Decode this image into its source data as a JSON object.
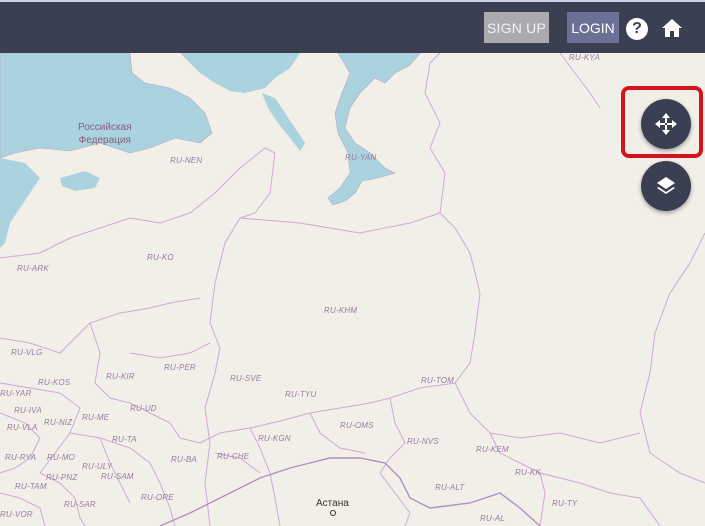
{
  "header": {
    "signup_label": "SIGN UP",
    "login_label": "LOGIN",
    "help_glyph": "?",
    "icons": [
      "help-icon",
      "home-icon"
    ]
  },
  "controls": {
    "pan_button_icon": "move-arrows-icon",
    "layers_button_icon": "layers-icon",
    "accent": "#3a3f51",
    "highlight_color": "#d4141c"
  },
  "map": {
    "place_labels": {
      "russia_line1": "Российская",
      "russia_line2": "Федерация"
    },
    "city_labels": {
      "astana": "Астана"
    },
    "region_labels": [
      "RU-KYA",
      "RU-NEN",
      "RU-YAN",
      "RU-ARK",
      "RU-KO",
      "RU-KHM",
      "RU-VLG",
      "RU-KIR",
      "RU-PER",
      "RU-SVE",
      "RU-TOM",
      "RU-KOS",
      "RU-YAR",
      "RU-UD",
      "RU-TYU",
      "RU-IVA",
      "RU-ME",
      "RU-NIZ",
      "RU-VLA",
      "RU-TA",
      "RU-KGN",
      "RU-OMS",
      "RU-NVS",
      "RU-RYA",
      "RU-MO",
      "RU-BA",
      "RU-CHE",
      "RU-KEM",
      "RU-ULY",
      "RU-PNZ",
      "RU-SAM",
      "RU-TAM",
      "RU-ALT",
      "RU-KK",
      "RU-ORE",
      "RU-SAR",
      "RU-VOR",
      "RU-AL",
      "RU-TY"
    ]
  }
}
